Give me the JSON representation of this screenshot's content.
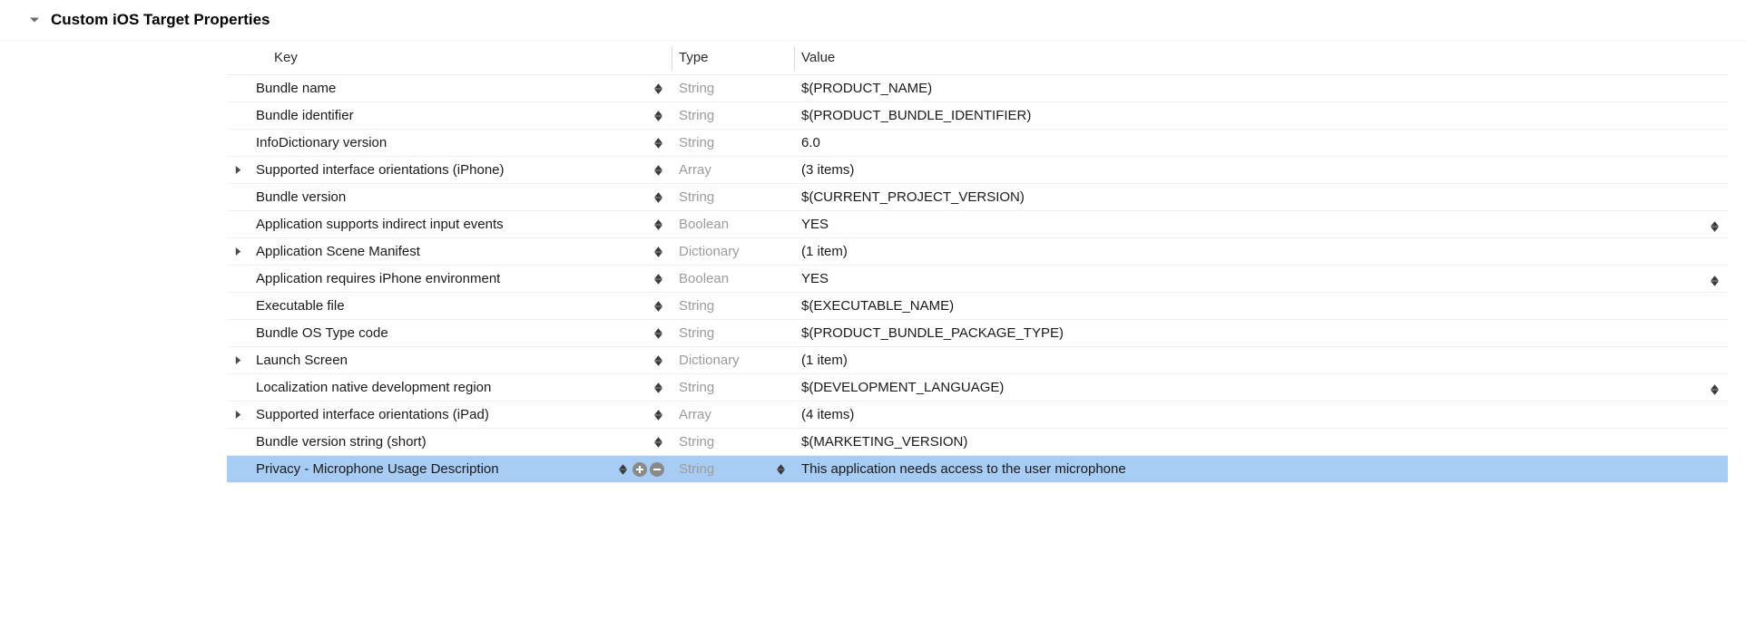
{
  "section": {
    "title": "Custom iOS Target Properties",
    "expanded": true
  },
  "columns": {
    "key": "Key",
    "type": "Type",
    "value": "Value"
  },
  "rows": [
    {
      "key": "Bundle name",
      "type": "String",
      "value": "$(PRODUCT_NAME)",
      "expandable": false,
      "trailingStepper": false
    },
    {
      "key": "Bundle identifier",
      "type": "String",
      "value": "$(PRODUCT_BUNDLE_IDENTIFIER)",
      "expandable": false,
      "trailingStepper": false
    },
    {
      "key": "InfoDictionary version",
      "type": "String",
      "value": "6.0",
      "expandable": false,
      "trailingStepper": false
    },
    {
      "key": "Supported interface orientations (iPhone)",
      "type": "Array",
      "value": "(3 items)",
      "expandable": true,
      "trailingStepper": false
    },
    {
      "key": "Bundle version",
      "type": "String",
      "value": "$(CURRENT_PROJECT_VERSION)",
      "expandable": false,
      "trailingStepper": false
    },
    {
      "key": "Application supports indirect input events",
      "type": "Boolean",
      "value": "YES",
      "expandable": false,
      "trailingStepper": true
    },
    {
      "key": "Application Scene Manifest",
      "type": "Dictionary",
      "value": "(1 item)",
      "expandable": true,
      "trailingStepper": false
    },
    {
      "key": "Application requires iPhone environment",
      "type": "Boolean",
      "value": "YES",
      "expandable": false,
      "trailingStepper": true
    },
    {
      "key": "Executable file",
      "type": "String",
      "value": "$(EXECUTABLE_NAME)",
      "expandable": false,
      "trailingStepper": false
    },
    {
      "key": "Bundle OS Type code",
      "type": "String",
      "value": "$(PRODUCT_BUNDLE_PACKAGE_TYPE)",
      "expandable": false,
      "trailingStepper": false
    },
    {
      "key": "Launch Screen",
      "type": "Dictionary",
      "value": "(1 item)",
      "expandable": true,
      "trailingStepper": false
    },
    {
      "key": "Localization native development region",
      "type": "String",
      "value": "$(DEVELOPMENT_LANGUAGE)",
      "expandable": false,
      "trailingStepper": true
    },
    {
      "key": "Supported interface orientations (iPad)",
      "type": "Array",
      "value": "(4 items)",
      "expandable": true,
      "trailingStepper": false
    },
    {
      "key": "Bundle version string (short)",
      "type": "String",
      "value": "$(MARKETING_VERSION)",
      "expandable": false,
      "trailingStepper": false
    },
    {
      "key": "Privacy - Microphone Usage Description",
      "type": "String",
      "value": "This application needs access to the user microphone",
      "expandable": false,
      "trailingStepper": false,
      "selected": true,
      "showActions": true,
      "showTypeStepper": true
    }
  ]
}
